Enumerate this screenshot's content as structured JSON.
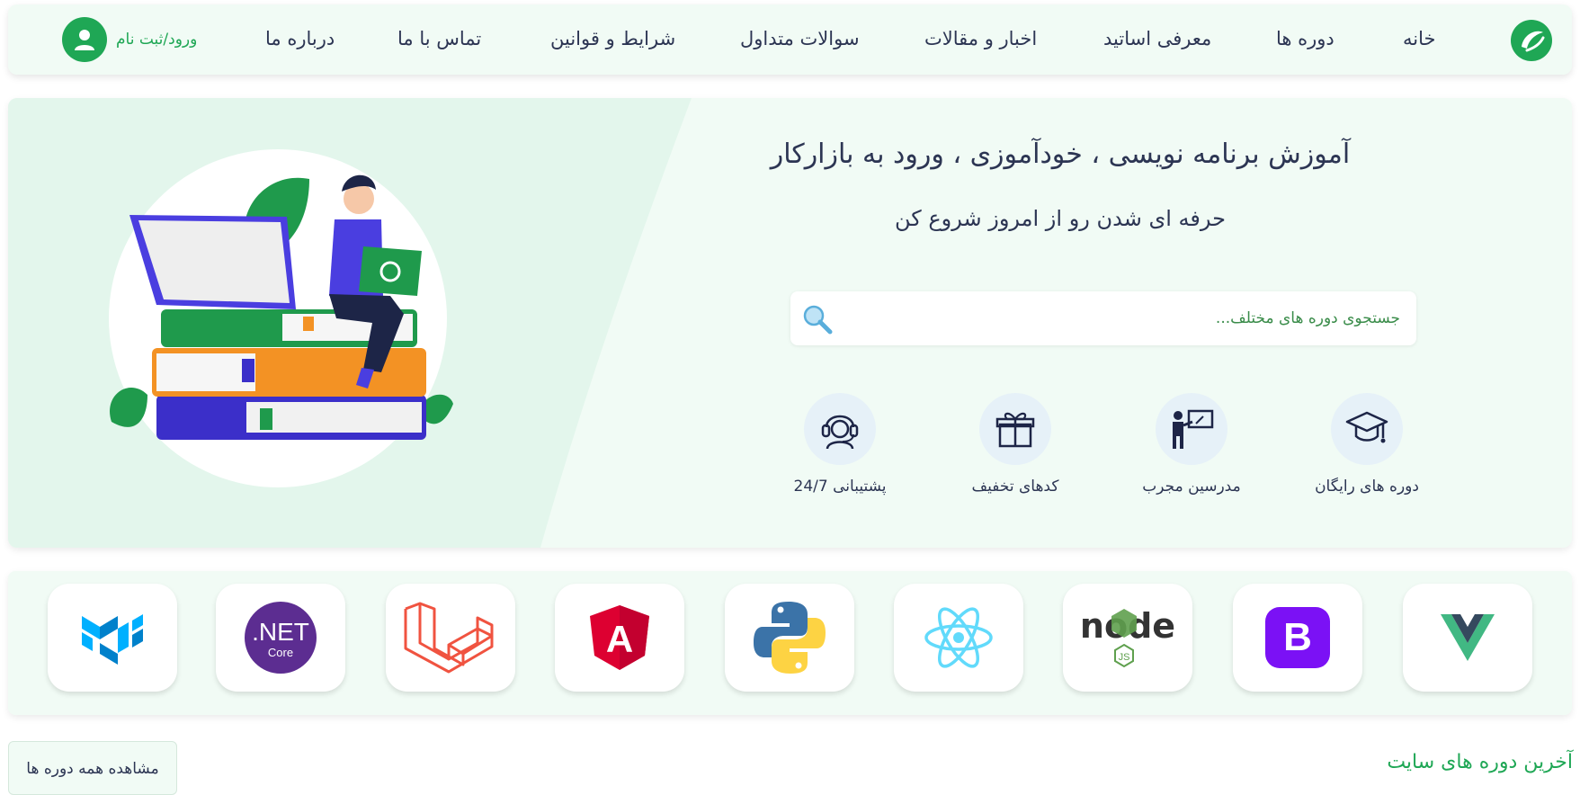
{
  "header": {
    "logo_icon": "brand-leaf-logo",
    "nav": [
      {
        "label": "خانه"
      },
      {
        "label": "دوره ها"
      },
      {
        "label": "معرفی اساتید"
      },
      {
        "label": "اخبار و مقالات"
      },
      {
        "label": "سوالات متداول"
      },
      {
        "label": "شرایط و قوانین"
      },
      {
        "label": "تماس با ما"
      },
      {
        "label": "درباره ما"
      }
    ],
    "login_label": "ورود/ثبت نام",
    "login_icon": "user-icon"
  },
  "hero": {
    "title": "آموزش برنامه نویسی ، خودآموزی ، ورود به بازارکار",
    "subtitle": "حرفه ای شدن رو از امروز شروع کن",
    "search_placeholder": "جستجوی دوره های مختلف...",
    "search_icon": "magnifier-icon",
    "features": [
      {
        "label": "دوره های رایگان",
        "icon": "graduation-cap-icon"
      },
      {
        "label": "مدرسین مجرب",
        "icon": "teacher-board-icon"
      },
      {
        "label": "کدهای تخفیف",
        "icon": "gift-icon"
      },
      {
        "label": "پشتیبانی 24/7",
        "icon": "headset-support-icon"
      }
    ],
    "illustration": "student-on-books-illustration"
  },
  "technologies": [
    {
      "name": "Vue",
      "icon": "vue-logo"
    },
    {
      "name": "Bootstrap",
      "icon": "bootstrap-logo",
      "text": "B"
    },
    {
      "name": "Node.js",
      "icon": "nodejs-logo",
      "text": "node",
      "sub": "JS"
    },
    {
      "name": "React",
      "icon": "react-logo"
    },
    {
      "name": "Python",
      "icon": "python-logo"
    },
    {
      "name": "Angular",
      "icon": "angular-logo",
      "text": "A"
    },
    {
      "name": "Laravel",
      "icon": "laravel-logo"
    },
    {
      "name": ".NET Core",
      "icon": "dotnet-core-logo",
      "text": ".NET",
      "sub": "Core"
    },
    {
      "name": "Material UI",
      "icon": "material-ui-logo"
    }
  ],
  "latest": {
    "title": "آخرین دوره های سایت",
    "view_all_label": "مشاهده همه دوره ها"
  },
  "colors": {
    "accent": "#1fa755",
    "text": "#2c3553",
    "panel": "#f1fbf5"
  }
}
